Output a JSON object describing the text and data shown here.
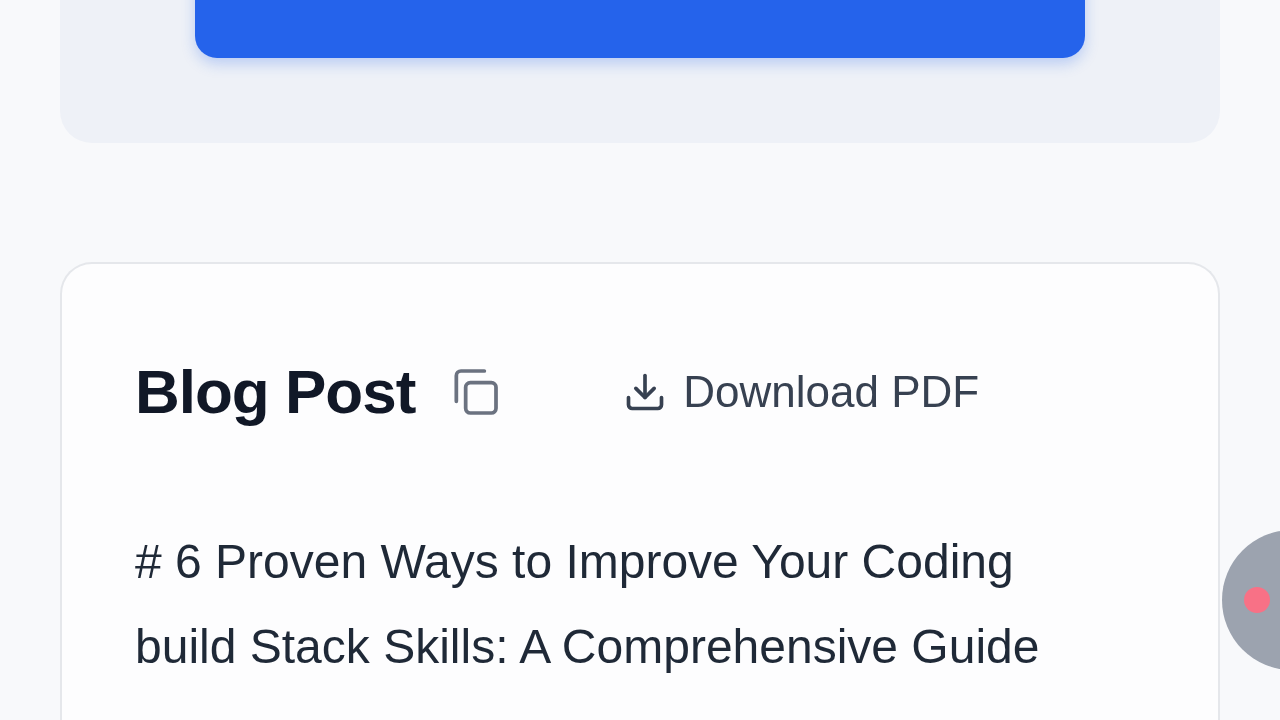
{
  "blog_card": {
    "title": "Blog Post",
    "download_label": "Download PDF",
    "content": "# 6 Proven Ways to Improve Your Coding build Stack Skills: A Comprehensive Guide"
  }
}
